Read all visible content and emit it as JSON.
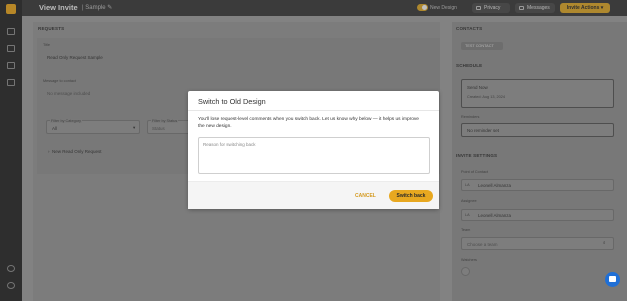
{
  "header": {
    "title": "View Invite",
    "crumb": "Sample",
    "toggle_label": "New Design",
    "privacy_label": "Privacy",
    "messages_label": "Messages",
    "actions_label": "Invite Actions ▾"
  },
  "requests": {
    "section": "REQUESTS",
    "title_label": "Title",
    "title_value": "Read Only Request Sample",
    "message_label": "Message to contact",
    "message_value": "No message included",
    "filter_category_label": "Filter by Category",
    "filter_category_value": "All",
    "filter_status_label": "Filter by Status",
    "filter_status_value": "Status",
    "request_item": "New Read Only Request"
  },
  "contacts": {
    "section": "CONTACTS",
    "chip": "TEST CONTACT"
  },
  "schedule": {
    "section": "SCHEDULE",
    "send_now": "Send Now",
    "created": "Created: Aug 13, 2024",
    "reminder_label": "Reminders",
    "reminder_value": "No reminder set"
  },
  "settings": {
    "section": "INVITE SETTINGS",
    "poc_label": "Point of Contact",
    "poc_initials": "LA",
    "poc_name": "Leonell Almanza",
    "assignee_label": "Assignee",
    "assignee_initials": "LA",
    "assignee_name": "Leonell Almanza",
    "team_label": "Team",
    "team_placeholder": "Choose a team",
    "watchers_label": "Watchers"
  },
  "modal": {
    "title": "Switch to Old Design",
    "body": "You'll lose request-level comments when you switch back. Let us know why below — it helps us improve the new design.",
    "placeholder": "Reason for switching back",
    "cancel": "CANCEL",
    "confirm": "Switch back"
  },
  "colors": {
    "accent": "#e8a820",
    "chat": "#1f6fd6"
  }
}
